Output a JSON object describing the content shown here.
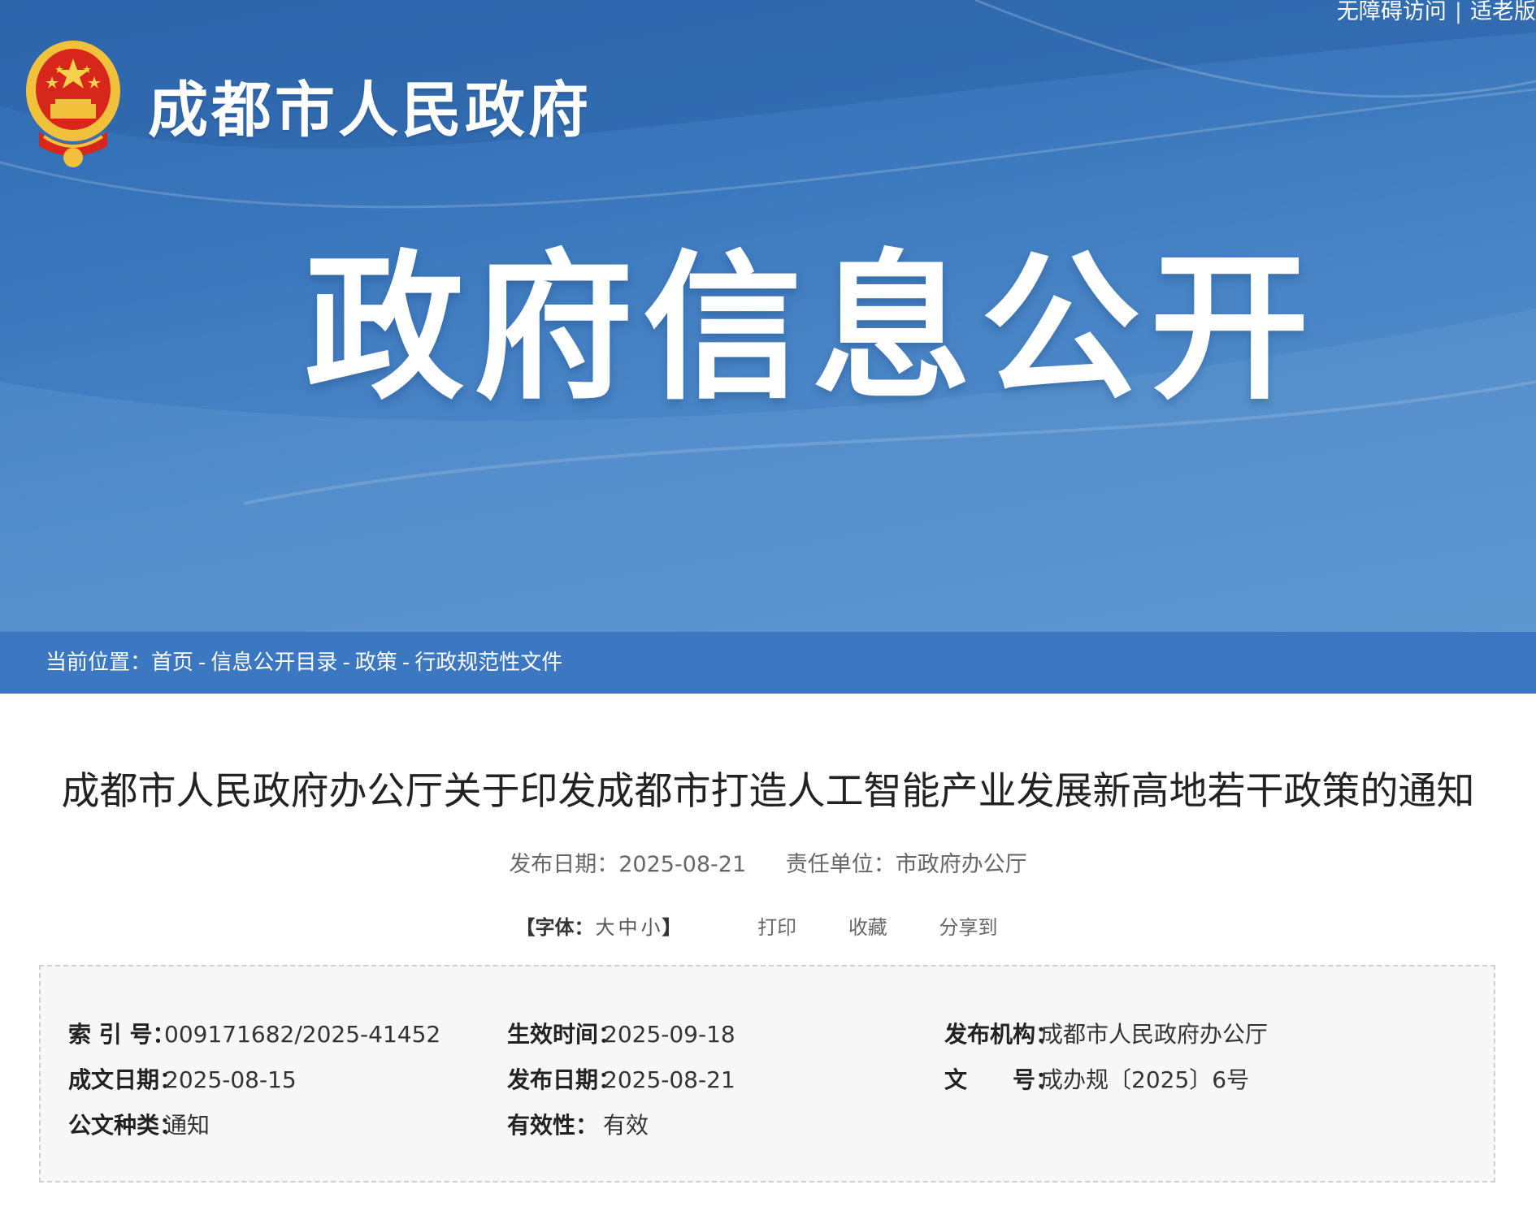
{
  "colors": {
    "banner_top": "#2f6ab0",
    "banner_bottom": "#5a93cf",
    "breadcrumb_bg": "#3b78c1",
    "title_text": "#222222",
    "meta_text": "#666666",
    "info_bg": "#f7f7f7",
    "emblem_red": "#d7261b",
    "emblem_gold": "#f2c13b"
  },
  "top_links": {
    "accessibility": "无障碍访问",
    "separator": "|",
    "elderly": "适老版"
  },
  "header": {
    "site_name": "成都市人民政府",
    "emblem_icon": "national-emblem-icon",
    "hero_title": "政府信息公开"
  },
  "breadcrumb": {
    "prefix": "当前位置：",
    "items": [
      "首页",
      "信息公开目录",
      "政策",
      "行政规范性文件"
    ],
    "separator": "-"
  },
  "article": {
    "title": "成都市人民政府办公厅关于印发成都市打造人工智能产业发展新高地若干政策的通知",
    "publish_date_label": "发布日期：",
    "publish_date": "2025-08-21",
    "unit_label": "责任单位：",
    "unit": "市政府办公厅",
    "font_label": "【字体：",
    "font_sizes": [
      "大",
      "中",
      "小"
    ],
    "font_close": "】",
    "actions": [
      "打印",
      "收藏",
      "分享到"
    ]
  },
  "info": {
    "rows": [
      [
        {
          "key": "索 引 号：",
          "value": "009171682/2025-41452"
        },
        {
          "key": "生效时间：",
          "value": "2025-09-18"
        },
        {
          "key": "发布机构：",
          "value": "成都市人民政府办公厅"
        }
      ],
      [
        {
          "key": "成文日期：",
          "value": "2025-08-15"
        },
        {
          "key": "发布日期：",
          "value": "2025-08-21"
        },
        {
          "key": "文　　号：",
          "value": "成办规〔2025〕6号"
        }
      ],
      [
        {
          "key": "公文种类：",
          "value": "通知"
        },
        {
          "key": "有效性：",
          "value": "有效"
        }
      ]
    ]
  }
}
